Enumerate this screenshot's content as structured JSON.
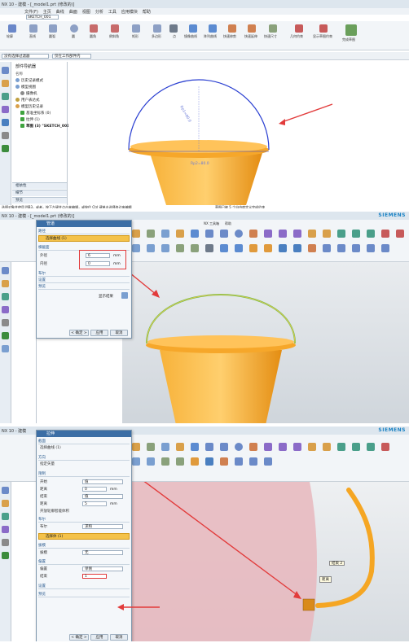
{
  "panel1": {
    "title": "NX 10 - 建模 - [_model1.prt (修改的)]",
    "menubar": [
      "文件(F)",
      "主页",
      "曲线",
      "曲面",
      "视图",
      "分析",
      "工具",
      "应用模块",
      "帮助"
    ],
    "sketch_name": "SKETCH_001",
    "ribbon_labels": [
      "轮廓",
      "直线",
      "圆弧",
      "圆",
      "圆角",
      "倒斜角",
      "矩形",
      "多边形",
      "点",
      "镜像曲线",
      "阵列曲线",
      "快速修剪",
      "快速延伸",
      "快速尺寸",
      "几何约束",
      "显示草图约束",
      "完成草图"
    ],
    "filter_label": "没有选择过滤器",
    "assembly_label": "仅在工作部件内",
    "nav_title": "部件导航器",
    "nav_header": "名称",
    "tree": [
      "历史记录模式",
      "模型视图",
      "摄像机",
      "用户表达式",
      "模型历史记录",
      "基准坐标系 (0)",
      "拉伸 (1)",
      "草图 (3) \"SKETCH_001\""
    ],
    "collapses": [
      "相依性",
      "细节",
      "预览"
    ],
    "status_left": "选择对象并使用 MB3，或者，按下左键并点击来编辑，或按住 Ctrl 键单击选择各边来编辑",
    "status_right": "草图已被 5 个自由度定义完成约束",
    "dimension_texts": [
      "Rp1=80.0",
      "Rp2=80.0"
    ]
  },
  "panel2": {
    "title": "NX 10 - 建模 - [_model1.prt (修改的)]",
    "siemens": "SIEMENS",
    "dialog": {
      "title": "管道",
      "sec_path": "路径",
      "path_select": "选择曲线 (1)",
      "sec_cross": "横截面",
      "outer_label": "外径",
      "outer_value": "6",
      "inner_label": "内径",
      "inner_value": "0",
      "unit": "mm",
      "sec_boolean": "布尔",
      "sec_settings": "设置",
      "sec_preview": "预览",
      "preview_show": "显示结果",
      "ok": "< 确定 >",
      "apply": "应用",
      "cancel": "取消"
    },
    "menu_right": [
      "NX 工具箱",
      "帮助"
    ]
  },
  "panel3": {
    "title": "NX 10 - 建模",
    "siemens": "SIEMENS",
    "dialog": {
      "title": "拉伸",
      "sec_section": "截面",
      "section_select": "选择曲线 (1)",
      "sec_direction": "方向",
      "direction_select": "指定矢量",
      "sec_limits": "限制",
      "start_label": "开始",
      "start_mode": "值",
      "start_dist_label": "距离",
      "start_dist": "0",
      "end_label": "结束",
      "end_mode": "值",
      "end_dist_label": "距离",
      "end_dist": "5",
      "unit": "mm",
      "open_profile": "开放轮廓智能体积",
      "sec_boolean": "布尔",
      "boolean_label": "布尔",
      "boolean_value": "求和",
      "select_body": "选择体 (1)",
      "sec_draft": "拔模",
      "draft_label": "拔模",
      "draft_value": "无",
      "sec_offset": "偏置",
      "offset_label": "偏置",
      "offset_value": "单侧",
      "end_offset_label": "结束",
      "end_offset_value": "1",
      "sec_settings": "设置",
      "sec_preview": "预览",
      "ok": "< 确定 >",
      "apply": "应用",
      "cancel": "取消"
    },
    "tooltip_value": "结束 2",
    "tooltip_label": "距离"
  },
  "colors": {
    "bucket": "#f5a623",
    "arc": "#2a3fd1",
    "handle_green": "#6cc04a",
    "arrow": "#e23b3b",
    "ribbon_bg": "#f2f5f8"
  }
}
